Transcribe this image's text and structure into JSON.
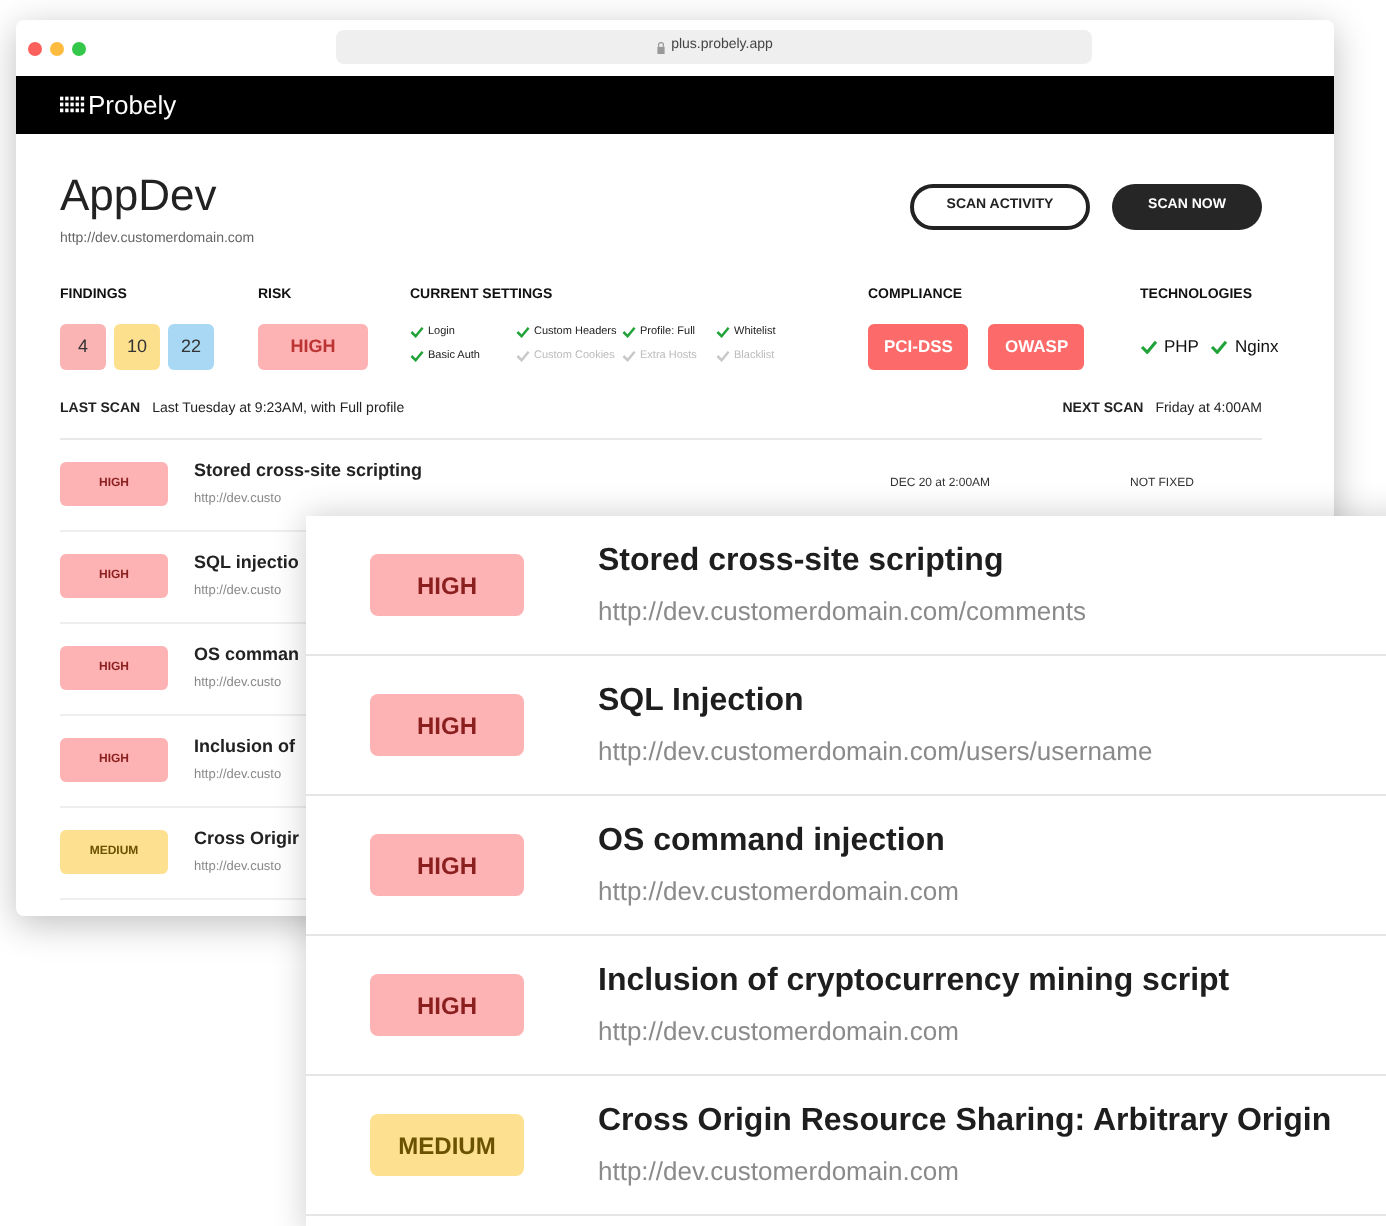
{
  "browser": {
    "address": "plus.probely.app"
  },
  "header": {
    "logo": "Probely"
  },
  "target": {
    "name": "AppDev",
    "url": "http://dev.customerdomain.com"
  },
  "actions": [
    {
      "label": "SCAN ACTIVITY",
      "kind": "outline"
    },
    {
      "label": "SCAN NOW",
      "kind": "solid"
    }
  ],
  "findings": {
    "title": "FINDINGS",
    "counts": [
      {
        "value": "4",
        "color": "#fbb4b4"
      },
      {
        "value": "10",
        "color": "#fde08e"
      },
      {
        "value": "22",
        "color": "#a8d8f3"
      }
    ]
  },
  "risk": {
    "title": "RISK",
    "value": "HIGH"
  },
  "settings": {
    "title": "CURRENT SETTINGS",
    "items": [
      {
        "label": "Login",
        "checked": true
      },
      {
        "label": "Basic Auth",
        "checked": true
      },
      {
        "label": "Custom Headers",
        "checked": true
      },
      {
        "label": "Custom Cookies",
        "checked": false
      },
      {
        "label": "Profile: Full",
        "checked": true
      },
      {
        "label": "Extra Hosts",
        "checked": false
      },
      {
        "label": "Whitelist",
        "checked": true
      },
      {
        "label": "Blacklist",
        "checked": false
      }
    ]
  },
  "compliance": {
    "title": "COMPLIANCE",
    "items": [
      "PCI-DSS",
      "OWASP"
    ]
  },
  "technologies": {
    "title": "TECHNOLOGIES",
    "items": [
      "PHP",
      "Nginx"
    ]
  },
  "last_scan": {
    "label": "LAST SCAN",
    "value": "Last Tuesday at 9:23AM, with Full profile"
  },
  "next_scan": {
    "label": "NEXT SCAN",
    "value": "Friday at 4:00AM"
  },
  "back_rows": [
    {
      "severity": "HIGH",
      "kind": "high",
      "title": "Stored cross-site scripting",
      "url": "http://dev.custo",
      "date": "DEC 20 at 2:00AM",
      "status": "NOT FIXED"
    },
    {
      "severity": "HIGH",
      "kind": "high",
      "title": "SQL injectio",
      "url": "http://dev.custo"
    },
    {
      "severity": "HIGH",
      "kind": "high",
      "title": "OS comman",
      "url": "http://dev.custo"
    },
    {
      "severity": "HIGH",
      "kind": "high",
      "title": "Inclusion of",
      "url": "http://dev.custo"
    },
    {
      "severity": "MEDIUM",
      "kind": "medium",
      "title": "Cross Origir",
      "url": "http://dev.custo"
    }
  ],
  "zoomed_rows": [
    {
      "severity": "HIGH",
      "kind": "high",
      "title": "Stored cross-site scripting",
      "url": "http://dev.customerdomain.com/comments"
    },
    {
      "severity": "HIGH",
      "kind": "high",
      "title": "SQL Injection",
      "url": "http://dev.customerdomain.com/users/username"
    },
    {
      "severity": "HIGH",
      "kind": "high",
      "title": "OS command injection",
      "url": "http://dev.customerdomain.com"
    },
    {
      "severity": "HIGH",
      "kind": "high",
      "title": "Inclusion of cryptocurrency mining script",
      "url": "http://dev.customerdomain.com"
    },
    {
      "severity": "MEDIUM",
      "kind": "medium",
      "title": "Cross Origin Resource Sharing: Arbitrary Origin",
      "url": "http://dev.customerdomain.com"
    }
  ]
}
